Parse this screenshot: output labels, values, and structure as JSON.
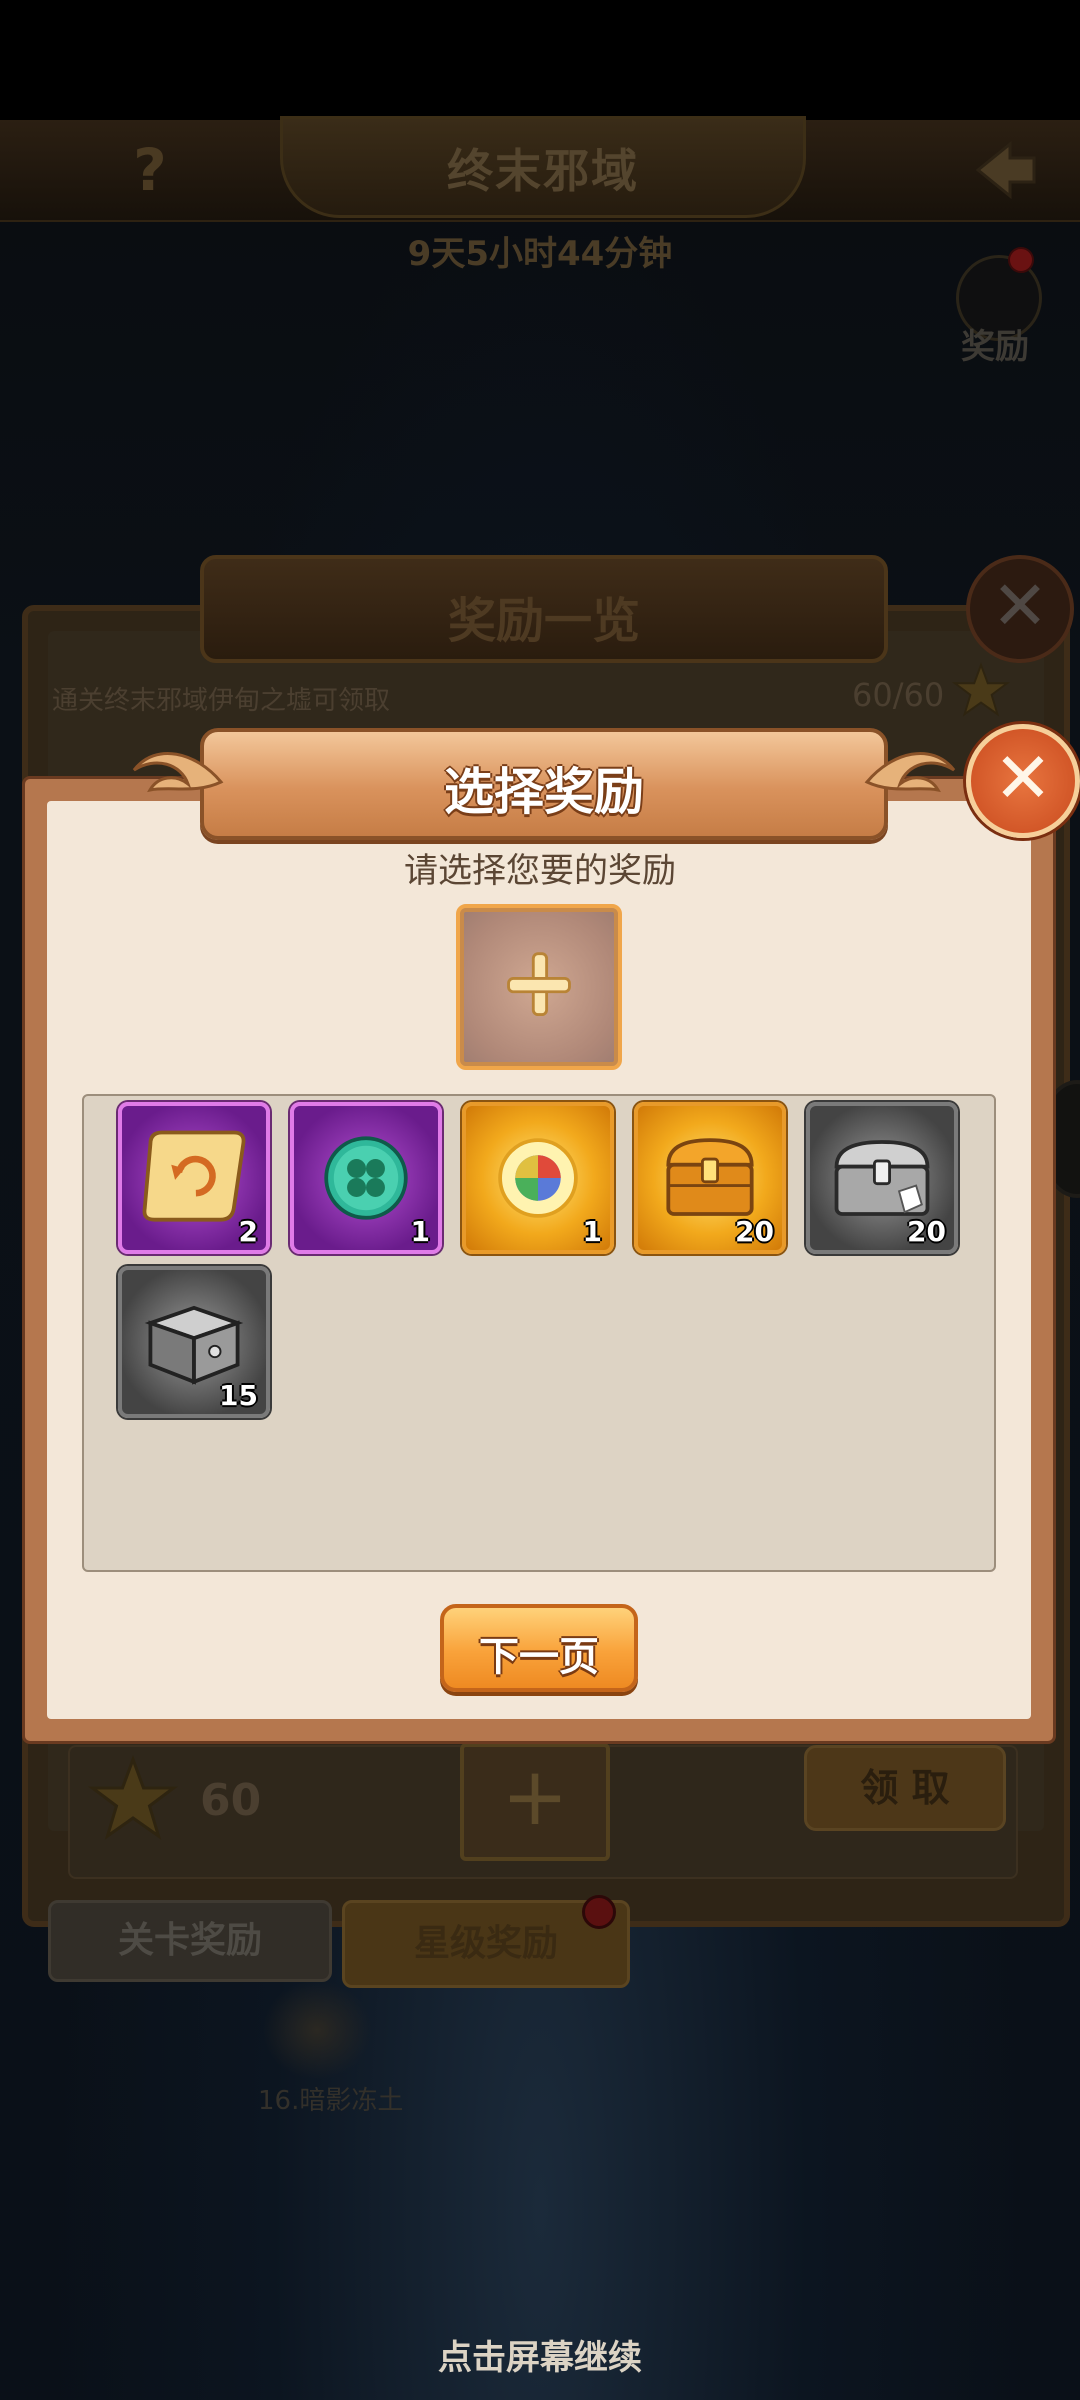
{
  "background": {
    "header_title": "终末邪域",
    "countdown": "9天5小时44分钟",
    "rewards_corner_label": "奖励",
    "overview": {
      "title": "奖励一览",
      "description": "通关终末邪域伊甸之墟可领取",
      "progress": "60/60",
      "row_stars": "60",
      "claim_label": "领 取"
    },
    "tabs": [
      "关卡奖励",
      "星级奖励"
    ],
    "stage_node_label": "16.暗影冻土",
    "continue_hint": "点击屏幕继续"
  },
  "dialog": {
    "title": "选择奖励",
    "prompt": "请选择您要的奖励",
    "next_page_label": "下一页"
  },
  "items": [
    {
      "icon": "scroll-icon",
      "rarity": "purple",
      "count": "2"
    },
    {
      "icon": "clover-orb-icon",
      "rarity": "purple",
      "count": "1"
    },
    {
      "icon": "elemental-orb-icon",
      "rarity": "gold",
      "count": "1"
    },
    {
      "icon": "golden-chest-icon",
      "rarity": "gold",
      "count": "20"
    },
    {
      "icon": "silver-chest-icon",
      "rarity": "gray",
      "count": "20"
    },
    {
      "icon": "iron-box-icon",
      "rarity": "gray",
      "count": "15"
    }
  ],
  "colors": {
    "dialog_bg": "#f3e7d8",
    "accent_orange": "#f9a23a",
    "close_red": "#c94a1e"
  }
}
